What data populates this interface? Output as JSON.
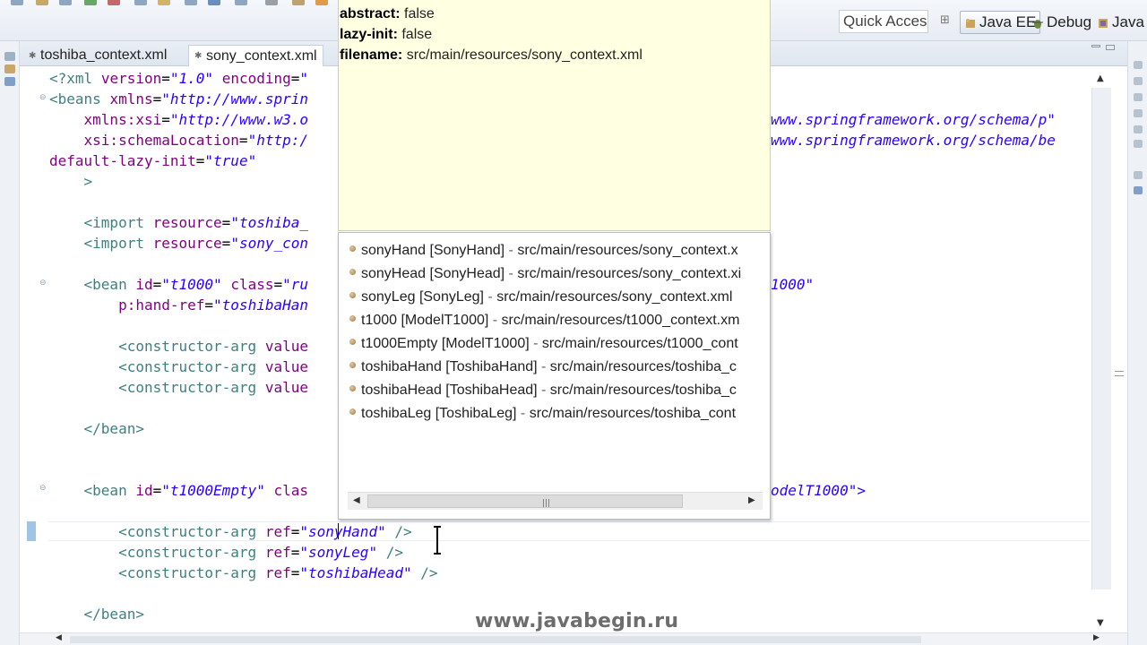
{
  "toolbar": {
    "quick_access_placeholder": "Quick Acces",
    "perspectives": [
      {
        "label": "Java EE",
        "active": true
      },
      {
        "label": "Debug",
        "active": false
      },
      {
        "label": "Java",
        "active": false
      }
    ]
  },
  "tabs": [
    {
      "label": "toshiba_context.xml",
      "active": false
    },
    {
      "label": "sony_context.xml",
      "active": true
    }
  ],
  "code_lines": [
    {
      "html": "<?xml version=\"1.0\" encoding=\""
    },
    {
      "html": "<beans xmlns=\"http://www.sprin"
    },
    {
      "html": "    xmlns:xsi=\"http://www.w3.o"
    },
    {
      "html": "    xsi:schemaLocation=\"http:/"
    },
    {
      "html": "default-lazy-init=\"true\""
    },
    {
      "html": "    >"
    },
    {
      "html": ""
    },
    {
      "html": "    <import resource=\"toshiba_"
    },
    {
      "html": "    <import resource=\"sony_con"
    },
    {
      "html": ""
    },
    {
      "html": "    <bean id=\"t1000\" class=\"ru"
    },
    {
      "html": "        p:hand-ref=\"toshibaHan"
    },
    {
      "html": ""
    },
    {
      "html": "        <constructor-arg value"
    },
    {
      "html": "        <constructor-arg value"
    },
    {
      "html": "        <constructor-arg value"
    },
    {
      "html": ""
    },
    {
      "html": "    </bean>"
    },
    {
      "html": ""
    },
    {
      "html": ""
    },
    {
      "html": "    <bean id=\"t1000Empty\" clas"
    },
    {
      "html": ""
    },
    {
      "html": "        <constructor-arg ref=\"sonyHand\" />"
    },
    {
      "html": "        <constructor-arg ref=\"sonyLeg\" />"
    },
    {
      "html": "        <constructor-arg ref=\"toshibaHead\" />"
    },
    {
      "html": ""
    },
    {
      "html": "    </bean>"
    }
  ],
  "right_fragments": [
    {
      "text": "www.springframework.org/schema/p\""
    },
    {
      "text": "www.springframework.org/schema/be"
    },
    {
      "text": "1000\""
    },
    {
      "text": "odelT1000\">"
    }
  ],
  "info_popup": {
    "rows": [
      {
        "key": "abstract:",
        "value": "false"
      },
      {
        "key": "lazy-init:",
        "value": "false"
      },
      {
        "key": "filename:",
        "value": "src/main/resources/sony_context.xml"
      }
    ]
  },
  "content_assist": {
    "items": [
      {
        "name": "sonyHand [SonyHand]",
        "path": "src/main/resources/sony_context.x"
      },
      {
        "name": "sonyHead [SonyHead]",
        "path": "src/main/resources/sony_context.xi"
      },
      {
        "name": "sonyLeg [SonyLeg]",
        "path": "src/main/resources/sony_context.xml"
      },
      {
        "name": "t1000 [ModelT1000]",
        "path": "src/main/resources/t1000_context.xm"
      },
      {
        "name": "t1000Empty [ModelT1000]",
        "path": "src/main/resources/t1000_cont"
      },
      {
        "name": "toshibaHand [ToshibaHand]",
        "path": "src/main/resources/toshiba_c"
      },
      {
        "name": "toshibaHead [ToshibaHead]",
        "path": "src/main/resources/toshiba_c"
      },
      {
        "name": "toshibaLeg [ToshibaLeg]",
        "path": "src/main/resources/toshiba_cont"
      }
    ]
  },
  "watermark": "www.javabegin.ru",
  "colors": {
    "xml_tag": "#3f7f7f",
    "xml_attr": "#7f007f",
    "xml_value": "#2a00ff",
    "popup_bg": "#ffffe1"
  }
}
